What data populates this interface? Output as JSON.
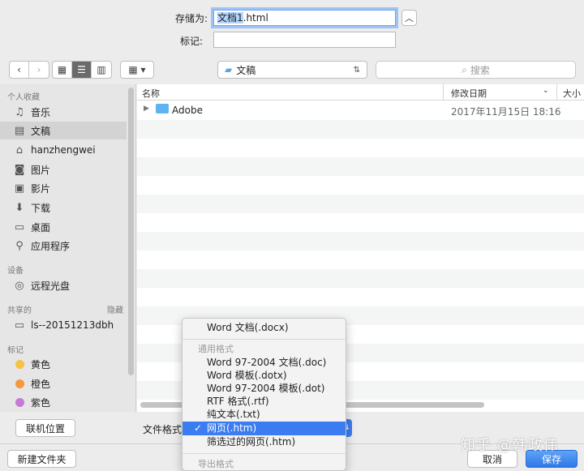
{
  "save_form": {
    "save_as_label": "存储为:",
    "filename_selected": "文档1",
    "filename_rest": ".html",
    "tags_label": "标记:",
    "tags_value": ""
  },
  "toolbar": {
    "location": "文稿",
    "search_placeholder": "搜索"
  },
  "sidebar": {
    "favorites_header": "个人收藏",
    "favorites": [
      {
        "label": "音乐",
        "icon": "music-icon"
      },
      {
        "label": "文稿",
        "icon": "document-icon"
      },
      {
        "label": "hanzhengwei",
        "icon": "home-icon"
      },
      {
        "label": "图片",
        "icon": "camera-icon"
      },
      {
        "label": "影片",
        "icon": "film-icon"
      },
      {
        "label": "下载",
        "icon": "download-icon"
      },
      {
        "label": "桌面",
        "icon": "desktop-icon"
      },
      {
        "label": "应用程序",
        "icon": "applications-icon"
      }
    ],
    "devices_header": "设备",
    "devices": [
      {
        "label": "远程光盘",
        "icon": "disc-icon"
      }
    ],
    "shared_header": "共享的",
    "shared_hide": "隐藏",
    "shared": [
      {
        "label": "ls--20151213dbh",
        "icon": "monitor-icon"
      }
    ],
    "tags_header": "标记",
    "tags": [
      {
        "label": "黄色",
        "color": "#f5c342"
      },
      {
        "label": "橙色",
        "color": "#f39a3d"
      },
      {
        "label": "紫色",
        "color": "#c57ad6"
      }
    ]
  },
  "file_list": {
    "columns": {
      "name": "名称",
      "modified": "修改日期",
      "size": "大小"
    },
    "rows": [
      {
        "name": "Adobe",
        "modified": "2017年11月15日 18:16"
      }
    ]
  },
  "bottom": {
    "online_button": "联机位置",
    "format_label": "文件格式",
    "new_folder_button": "新建文件夹",
    "cancel_button": "取消",
    "save_button": "保存"
  },
  "format_menu": {
    "top_item": "Word 文档(.docx)",
    "common_header": "通用格式",
    "common_items": [
      "Word 97-2004 文档(.doc)",
      "Word 模板(.dotx)",
      "Word 97-2004 模板(.dot)",
      "RTF 格式(.rtf)",
      "纯文本(.txt)",
      "网页(.htm)",
      "筛选过的网页(.htm)"
    ],
    "selected_index": 5,
    "export_header": "导出格式"
  },
  "watermark": "知乎 @韩政伟"
}
